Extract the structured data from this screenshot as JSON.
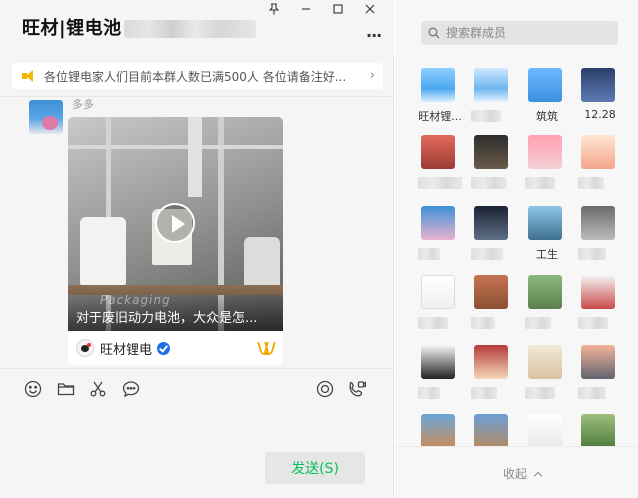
{
  "window": {
    "title": "旺材|锂电池",
    "icons": {
      "pin": "pin-icon",
      "minimize": "minimize-icon",
      "maximize": "maximize-icon",
      "close": "close-icon"
    }
  },
  "chat": {
    "more": "···",
    "notice": "各位锂电家人们目前本群人数已满500人 各位请备注好...",
    "message": {
      "sender": "多多",
      "video_caption": "对于废旧动力电池，大众是怎...",
      "watermark": "Packaging",
      "channel_name": "旺材锂电",
      "verified": true
    },
    "toolbar": [
      "emoji-icon",
      "folder-icon",
      "scissors-icon",
      "chat-bubble-icon",
      "live-icon",
      "video-call-icon"
    ],
    "send_label": "发送(S)"
  },
  "members": {
    "search_placeholder": "搜索群成员",
    "list": [
      {
        "name": "旺材锂..."
      },
      {
        "name": ""
      },
      {
        "name": "筑筑"
      },
      {
        "name": "12.28"
      },
      {
        "name": ""
      },
      {
        "name": ""
      },
      {
        "name": ""
      },
      {
        "name": ""
      },
      {
        "name": ""
      },
      {
        "name": ""
      },
      {
        "name": "工生"
      },
      {
        "name": ""
      },
      {
        "name": ""
      },
      {
        "name": ""
      },
      {
        "name": ""
      },
      {
        "name": ""
      },
      {
        "name": ""
      },
      {
        "name": ""
      },
      {
        "name": ""
      },
      {
        "name": ""
      },
      {
        "name": ""
      },
      {
        "name": ""
      },
      {
        "name": ""
      },
      {
        "name": ""
      }
    ],
    "collapse_label": "收起"
  },
  "colors": {
    "accent": "#07c160",
    "notice_icon": "#f5b800",
    "verified": "#1e6fe8"
  }
}
